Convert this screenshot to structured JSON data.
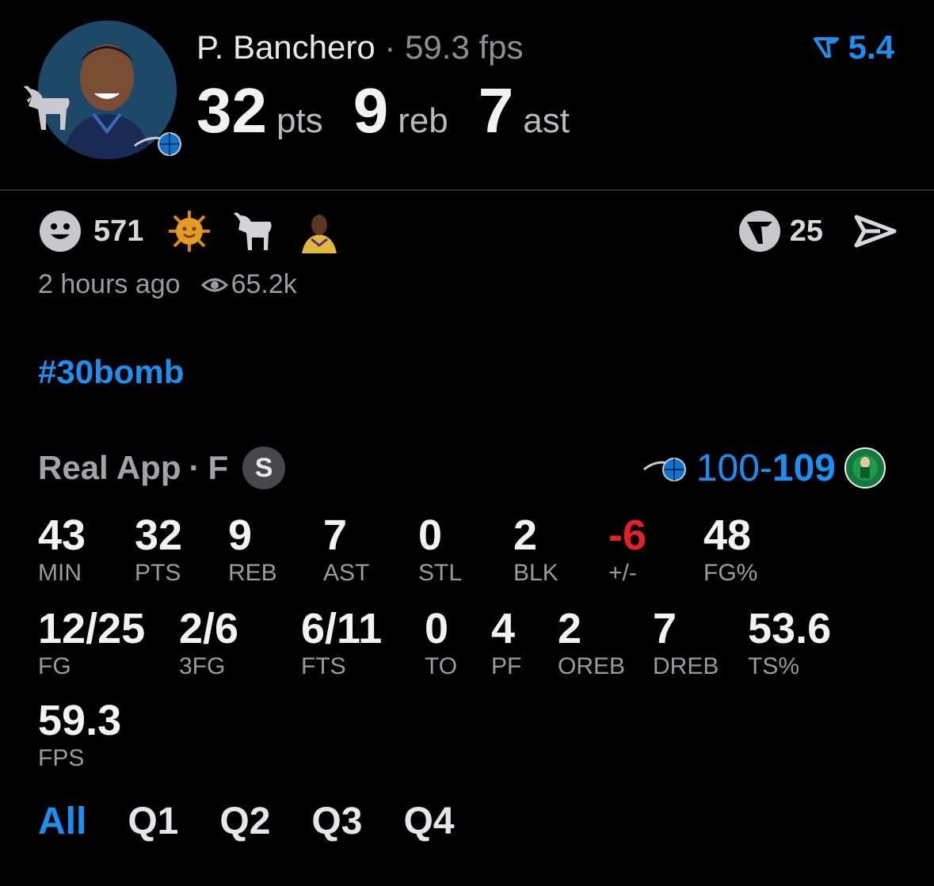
{
  "player": {
    "name": "P. Banchero",
    "separator": "·",
    "fps": "59.3 fps",
    "pts": "32",
    "pts_label": "pts",
    "reb": "9",
    "reb_label": "reb",
    "ast": "7",
    "ast_label": "ast",
    "avatar_icon": "player-avatar",
    "team_icon": "magic-logo-icon"
  },
  "vote": {
    "icon": "vote-arrow-icon",
    "value": "5.4"
  },
  "reactions": {
    "smile_count": "571",
    "icons": [
      "smile-icon",
      "sun-icon",
      "goat-icon",
      "player-emoji-icon"
    ]
  },
  "share": {
    "logo_count": "25",
    "icons": [
      "real-logo-icon",
      "send-icon"
    ]
  },
  "meta": {
    "time": "2 hours ago",
    "views": "65.2k"
  },
  "hashtag": "#30bomb",
  "game": {
    "source": "Real App",
    "sep": "·",
    "position": "F",
    "badge": "S",
    "home_score": "100",
    "dash": "-",
    "away_score": "109",
    "home_icon": "magic-logo-icon",
    "away_icon": "celtics-logo-icon"
  },
  "stats_row1": [
    {
      "value": "43",
      "label": "MIN"
    },
    {
      "value": "32",
      "label": "PTS"
    },
    {
      "value": "9",
      "label": "REB"
    },
    {
      "value": "7",
      "label": "AST"
    },
    {
      "value": "0",
      "label": "STL"
    },
    {
      "value": "2",
      "label": "BLK"
    },
    {
      "value": "-6",
      "label": "+/-"
    },
    {
      "value": "48",
      "label": "FG%"
    }
  ],
  "stats_row2": [
    {
      "value": "12/25",
      "label": "FG"
    },
    {
      "value": "2/6",
      "label": "3FG"
    },
    {
      "value": "6/11",
      "label": "FTS"
    },
    {
      "value": "0",
      "label": "TO"
    },
    {
      "value": "4",
      "label": "PF"
    },
    {
      "value": "2",
      "label": "OREB"
    },
    {
      "value": "7",
      "label": "DREB"
    },
    {
      "value": "53.6",
      "label": "TS%"
    }
  ],
  "stats_row3": [
    {
      "value": "59.3",
      "label": "FPS"
    }
  ],
  "tabs": [
    "All",
    "Q1",
    "Q2",
    "Q3",
    "Q4"
  ],
  "colors": {
    "accent": "#1d8ff2",
    "negative": "#e5202b",
    "background": "#000000"
  }
}
